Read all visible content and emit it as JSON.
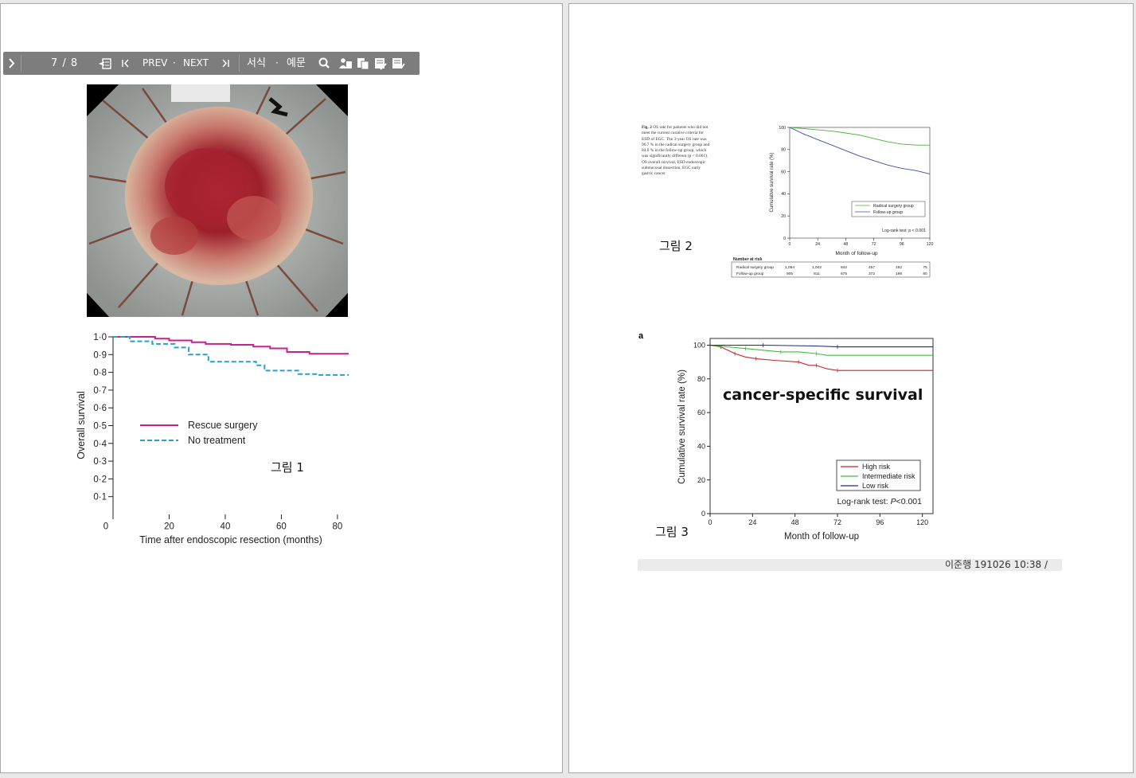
{
  "toolbar": {
    "page_indicator": "7 / 8",
    "prev_label": "PREV",
    "next_label": "NEXT",
    "dot": "·",
    "format_label": "서식",
    "example_label": "예문"
  },
  "figure1": {
    "label": "그림 1",
    "chart_data": {
      "type": "line",
      "xlabel": "Time after endoscopic resection (months)",
      "ylabel": "Overall survival",
      "xlim": [
        0,
        84
      ],
      "ylim": [
        0,
        1
      ],
      "x_ticks": [
        "0",
        "20",
        "40",
        "60",
        "80"
      ],
      "y_ticks": [
        "0·1",
        "0·2",
        "0·3",
        "0·4",
        "0·5",
        "0·6",
        "0·7",
        "0·8",
        "0·9",
        "1·0"
      ],
      "legend_position": "center-left",
      "series": [
        {
          "name": "Rescue surgery",
          "color": "#c8218c",
          "style": "solid",
          "x": [
            0,
            15,
            15,
            20,
            20,
            28,
            28,
            33,
            33,
            42,
            42,
            50,
            50,
            56,
            56,
            62,
            62,
            70,
            70,
            84
          ],
          "y": [
            1.0,
            1.0,
            0.99,
            0.99,
            0.98,
            0.98,
            0.97,
            0.97,
            0.96,
            0.96,
            0.955,
            0.955,
            0.945,
            0.945,
            0.935,
            0.935,
            0.915,
            0.915,
            0.905,
            0.905
          ]
        },
        {
          "name": "No treatment",
          "color": "#2a9fc9",
          "style": "dashed",
          "x": [
            0,
            6,
            6,
            14,
            14,
            22,
            22,
            27,
            27,
            34,
            34,
            51,
            51,
            54,
            54,
            66,
            66,
            73,
            73,
            84
          ],
          "y": [
            1.0,
            1.0,
            0.975,
            0.975,
            0.96,
            0.96,
            0.94,
            0.94,
            0.9,
            0.9,
            0.86,
            0.86,
            0.84,
            0.84,
            0.81,
            0.81,
            0.79,
            0.79,
            0.785,
            0.785
          ]
        }
      ]
    }
  },
  "figure2": {
    "label": "그림 2",
    "caption_title": "Fig. 2",
    "caption": "OS rate for patients who did not meet the current curative criteria for ESD of EGC. The 3-year OS rate was 96.7 % in the radical surgery group and 84.0 % in the follow-up group, which was significantly different (p < 0.001). OS overall survival, ESD endoscopic submucosal dissection, EGC early gastric cancer",
    "chart_data": {
      "type": "line",
      "xlabel": "Month of follow-up",
      "ylabel": "Cumulative survival rate (%)",
      "xlim": [
        0,
        120
      ],
      "ylim": [
        0,
        100
      ],
      "x_ticks": [
        "0",
        "24",
        "48",
        "72",
        "96",
        "120"
      ],
      "y_ticks": [
        "0",
        "20",
        "40",
        "60",
        "80",
        "100"
      ],
      "legend_position": "bottom-right",
      "annotation": "Log-rank test: p < 0.001",
      "series": [
        {
          "name": "Radical surgery group",
          "color": "#4caf3c",
          "x": [
            0,
            12,
            24,
            36,
            48,
            60,
            72,
            84,
            96,
            108,
            120
          ],
          "y": [
            100,
            99,
            97.8,
            96.7,
            95,
            93,
            90,
            87,
            85,
            84,
            84
          ]
        },
        {
          "name": "Follow-up group",
          "color": "#3a4fa0",
          "x": [
            0,
            12,
            24,
            36,
            48,
            60,
            72,
            84,
            96,
            108,
            120
          ],
          "y": [
            100,
            94,
            89,
            84,
            79,
            74,
            70,
            66,
            63,
            61,
            58
          ]
        }
      ]
    },
    "risk_table": {
      "title": "Number at risk",
      "rows": [
        {
          "label": "Radical surgery group",
          "values": [
            "1,064",
            "1,042",
            "942",
            "457",
            "192",
            "75"
          ]
        },
        {
          "label": "Follow-up group",
          "values": [
            "905",
            "811",
            "675",
            "372",
            "198",
            "80"
          ]
        }
      ]
    }
  },
  "figure3": {
    "label": "그림 3",
    "panel_letter": "a",
    "overlay_title": "cancer-specific survival",
    "chart_data": {
      "type": "line",
      "xlabel": "Month of follow-up",
      "ylabel": "Cumulative survival rate (%)",
      "xlim": [
        0,
        126
      ],
      "ylim": [
        0,
        104
      ],
      "x_ticks": [
        "0",
        "24",
        "48",
        "72",
        "96",
        "120"
      ],
      "y_ticks": [
        "0",
        "20",
        "40",
        "60",
        "80",
        "100"
      ],
      "legend_position": "bottom-right",
      "annotation_prefix": "Log-rank test: ",
      "annotation_p": "P",
      "annotation_value": "<0.001",
      "series": [
        {
          "name": "High risk",
          "color": "#c0282d",
          "x": [
            0,
            6,
            10,
            14,
            20,
            26,
            36,
            50,
            56,
            60,
            66,
            72,
            126
          ],
          "y": [
            100,
            99,
            97,
            95,
            93,
            92,
            91,
            90,
            88,
            88,
            86,
            85,
            85
          ]
        },
        {
          "name": "Intermediate risk",
          "color": "#3fbf3f",
          "x": [
            0,
            20,
            30,
            40,
            50,
            60,
            66,
            126
          ],
          "y": [
            100,
            98,
            97,
            96,
            96,
            95,
            94,
            94
          ]
        },
        {
          "name": "Low risk",
          "color": "#1e2a8c",
          "x": [
            0,
            30,
            60,
            72,
            126
          ],
          "y": [
            100,
            100,
            99.5,
            99,
            99
          ]
        }
      ]
    }
  },
  "footer": {
    "text": "이준행 191026 10:38 /"
  }
}
